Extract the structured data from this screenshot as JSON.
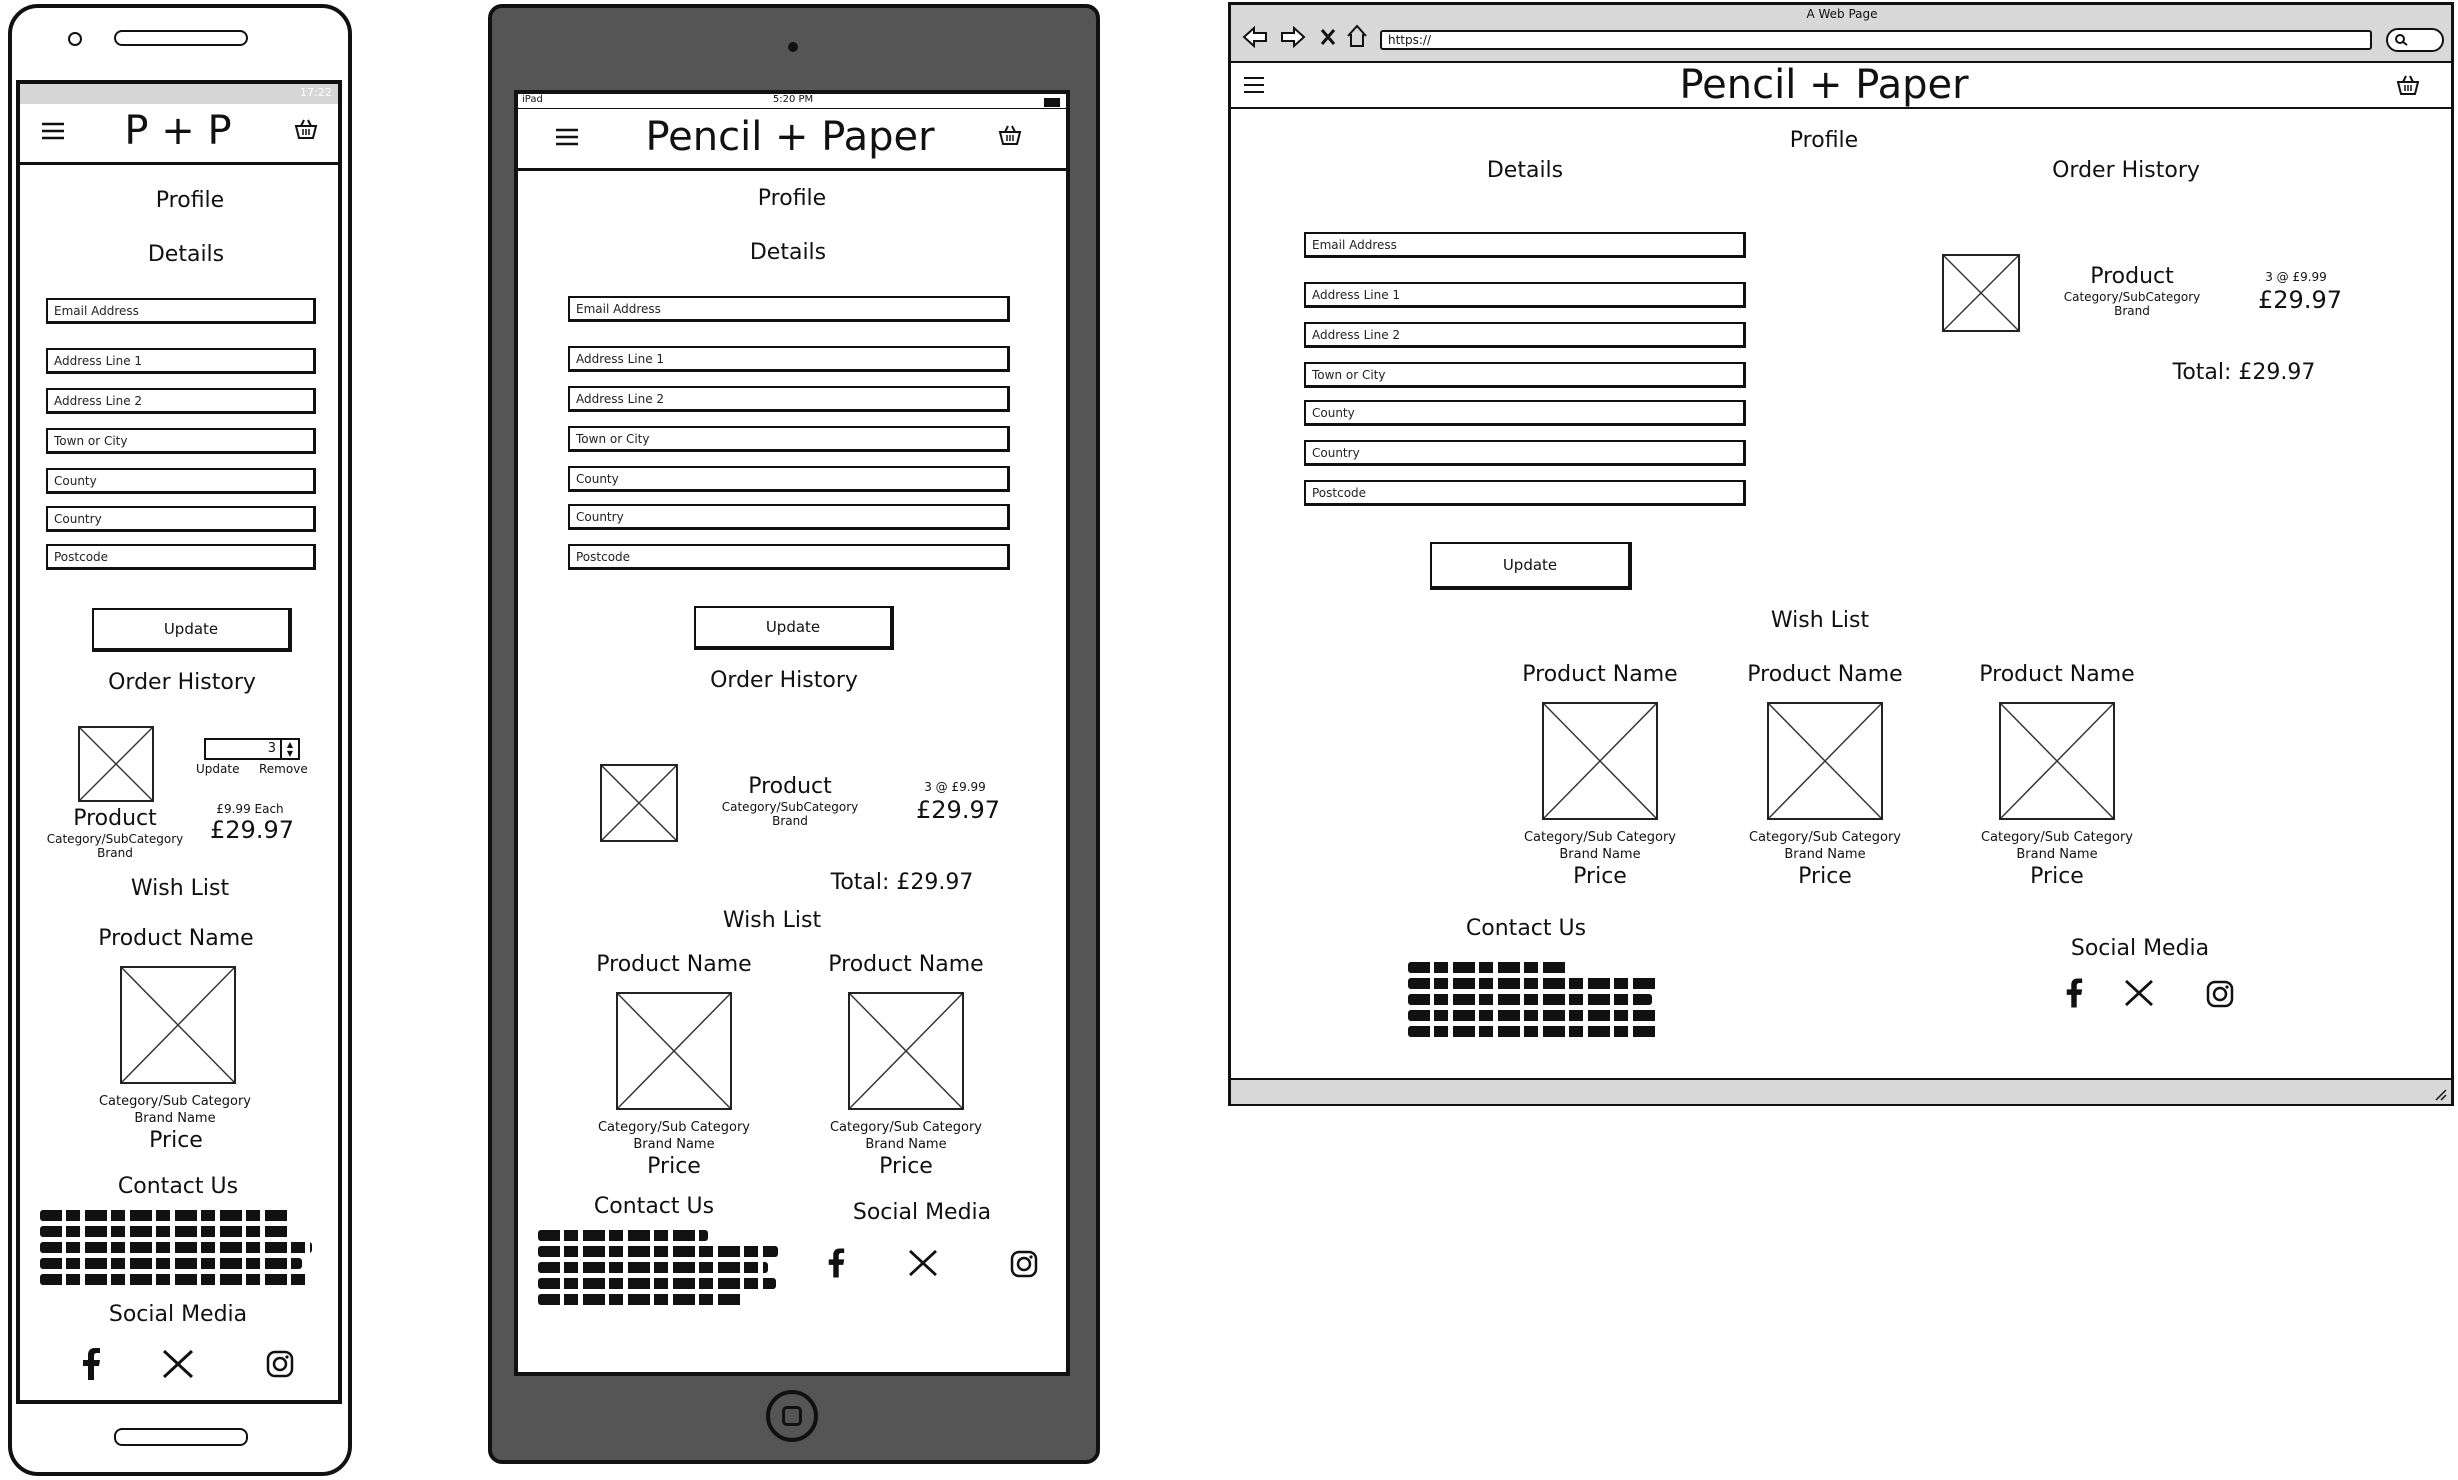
{
  "phone": {
    "status_time": "17:22",
    "logo": "P + P",
    "profile": "Profile",
    "details": "Details",
    "fields": [
      "Email Address",
      "Address Line 1",
      "Address Line 2",
      "Town or City",
      "County",
      "Country",
      "Postcode"
    ],
    "update_button": "Update",
    "order_history": "Order History",
    "qty_value": "3",
    "qty_update": "Update",
    "qty_remove": "Remove",
    "product": "Product",
    "category": "Category/SubCategory",
    "brand": "Brand",
    "each_price": "£9.99 Each",
    "total_price": "£29.97",
    "wish_list": "Wish List",
    "wish_product_name": "Product Name",
    "wish_category": "Category/Sub Category",
    "wish_brand": "Brand Name",
    "wish_price": "Price",
    "contact_us": "Contact Us",
    "social_media": "Social Media"
  },
  "tablet": {
    "status_device": "iPad",
    "status_time": "5:20 PM",
    "logo": "Pencil + Paper",
    "profile": "Profile",
    "details": "Details",
    "fields": [
      "Email Address",
      "Address Line 1",
      "Address Line 2",
      "Town or City",
      "County",
      "Country",
      "Postcode"
    ],
    "update_button": "Update",
    "order_history": "Order History",
    "product": "Product",
    "category": "Category/SubCategory",
    "brand": "Brand",
    "qty_price": "3 @ £9.99",
    "total_price": "£29.97",
    "order_total": "Total: £29.97",
    "wish_list": "Wish List",
    "wish_items": [
      {
        "name": "Product Name",
        "category": "Category/Sub Category",
        "brand": "Brand Name",
        "price": "Price"
      },
      {
        "name": "Product Name",
        "category": "Category/Sub Category",
        "brand": "Brand Name",
        "price": "Price"
      }
    ],
    "contact_us": "Contact Us",
    "social_media": "Social Media"
  },
  "desktop": {
    "window_title": "A Web Page",
    "url": "https://",
    "logo": "Pencil + Paper",
    "profile": "Profile",
    "details": "Details",
    "order_history": "Order History",
    "fields": [
      "Email Address",
      "Address Line 1",
      "Address Line 2",
      "Town or City",
      "County",
      "Country",
      "Postcode"
    ],
    "update_button": "Update",
    "product": "Product",
    "category": "Category/SubCategory",
    "brand": "Brand",
    "qty_price": "3 @ £9.99",
    "total_price": "£29.97",
    "order_total": "Total: £29.97",
    "wish_list": "Wish List",
    "wish_items": [
      {
        "name": "Product Name",
        "category": "Category/Sub Category",
        "brand": "Brand Name",
        "price": "Price"
      },
      {
        "name": "Product Name",
        "category": "Category/Sub Category",
        "brand": "Brand Name",
        "price": "Price"
      },
      {
        "name": "Product Name",
        "category": "Category/Sub Category",
        "brand": "Brand Name",
        "price": "Price"
      }
    ],
    "contact_us": "Contact Us",
    "social_media": "Social Media"
  },
  "icons": [
    "hamburger-menu-icon",
    "basket-icon",
    "facebook-icon",
    "x-twitter-icon",
    "instagram-icon",
    "back-arrow-icon",
    "forward-arrow-icon",
    "stop-icon",
    "home-icon",
    "search-icon",
    "wifi-icon",
    "battery-icon",
    "home-button-icon"
  ]
}
